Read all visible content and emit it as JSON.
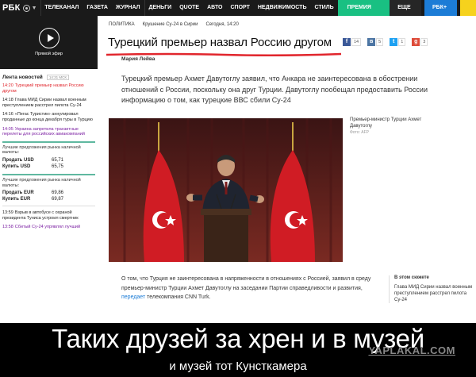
{
  "nav": {
    "logo": "РБК",
    "items": [
      "ТЕЛЕКАНАЛ",
      "ГАЗЕТА",
      "ЖУРНАЛ",
      "ДЕНЬГИ",
      "QUOTE",
      "АВТО",
      "СПОРТ",
      "НЕДВИЖИМОСТЬ",
      "СТИЛЬ"
    ],
    "premium": "ПРЕМИЯ РБК",
    "more": "ЕЩЕ ▾",
    "tv": "РБК+ ▸"
  },
  "sidebar": {
    "efir_label": "Прямой эфир",
    "news_title": "Лента новостей",
    "news_badge": "14:31 МСК",
    "news": [
      {
        "time": "14:20",
        "text": "Турецкий премьер назвал Россию другом",
        "style": "red"
      },
      {
        "time": "14:18",
        "text": "Глава МИД Сирии назвал военным преступлением расстрел пилота Су-24",
        "style": "normal"
      },
      {
        "time": "14:16",
        "text": "«Пегас Туристик» аннулировал проданные до конца декабря туры в Турцию",
        "style": "normal"
      },
      {
        "time": "14:05",
        "text": "Украина запретила транзитные перелеты для российских авиакомпаний",
        "style": "purple"
      }
    ],
    "rates_usd": {
      "title": "Лучшие предложения рынка наличной валюты:",
      "rows": [
        {
          "label": "Продать",
          "cur": "USD",
          "value": "65,71"
        },
        {
          "label": "Купить",
          "cur": "USD",
          "value": "65,75"
        }
      ]
    },
    "rates_eur": {
      "title": "Лучшие предложения рынка наличной валюты:",
      "rows": [
        {
          "label": "Продать",
          "cur": "EUR",
          "value": "69,86"
        },
        {
          "label": "Купить",
          "cur": "EUR",
          "value": "69,87"
        }
      ]
    },
    "news2": [
      {
        "time": "13:59",
        "text": "Взрыв в автобусе с охраной президента Туниса устроил смертник",
        "style": "normal"
      },
      {
        "time": "13:58",
        "text": "Сбитый Су-24 упрявлял лучший",
        "style": "purple"
      }
    ]
  },
  "article": {
    "crumbs": [
      "ПОЛИТИКА",
      "Крушение Су-24 в Сирии",
      "Сегодня, 14:20"
    ],
    "headline": "Турецкий премьер назвал Россию другом",
    "shares": [
      {
        "icon": "facebook-icon",
        "glyph": "f",
        "count": "14",
        "color": "#3b5998"
      },
      {
        "icon": "vk-icon",
        "glyph": "в",
        "count": "5",
        "color": "#4c75a3"
      },
      {
        "icon": "twitter-icon",
        "glyph": "t",
        "count": "1",
        "color": "#1da1f2"
      },
      {
        "icon": "googleplus-icon",
        "glyph": "g",
        "count": "3",
        "color": "#dd4b39"
      }
    ],
    "author": "Мария Лейва",
    "lead": "Турецкий премьер Ахмет Давутоглу заявил, что Анкара не заинтересована в обострении отношений с России, поскольку она друг Турции. Давутоглу пообещал предоставить России информацию о том, как турецкие ВВС сбили Су-24",
    "caption": "Премьер-министр Турции Ахмет Давутоглу",
    "photo_source": "Фото: AFP",
    "body_before": "О том, что Турция не заинтересована в напряженности в отношениях с Россией, заявил в среду премьер-министр Турции Ахмет Давутоглу на заседании Партии справедливости и развития, ",
    "body_link": "передает",
    "body_after": " телекомпания CNN Turk.",
    "aside_title": "В этом сюжете",
    "aside_text": "Глава МИД Сирии назвал военным преступлением расстрел пилота Су-24"
  },
  "meme": {
    "main": "Таких друзей за хрен и в музей",
    "sub": "и музей тот Кунсткамера",
    "watermark": "YAPLAKAL.COM"
  },
  "colors": {
    "accent_red": "#e1262d",
    "premium_green": "#19c082",
    "tv_blue": "#1c7cd6",
    "nav_bg": "#1a1a1a"
  }
}
